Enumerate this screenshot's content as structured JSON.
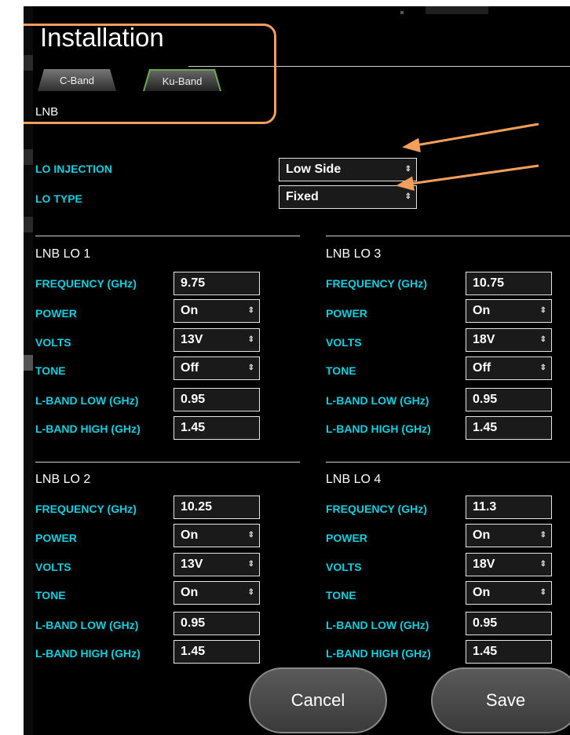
{
  "window": {
    "title": "Installation"
  },
  "tabs": [
    {
      "label": "C-Band",
      "active": false
    },
    {
      "label": "Ku-Band",
      "active": true
    }
  ],
  "section_label": "LNB",
  "lo_injection": {
    "label": "LO INJECTION",
    "value": "Low Side"
  },
  "lo_type": {
    "label": "LO TYPE",
    "value": "Fixed"
  },
  "field_labels": {
    "frequency": "FREQUENCY (GHz)",
    "power": "POWER",
    "volts": "VOLTS",
    "tone": "TONE",
    "lband_low": "L-BAND LOW (GHz)",
    "lband_high": "L-BAND HIGH (GHz)"
  },
  "lnb": {
    "lo1": {
      "title": "LNB LO 1",
      "frequency": "9.75",
      "power": "On",
      "volts": "13V",
      "tone": "Off",
      "lband_low": "0.95",
      "lband_high": "1.45"
    },
    "lo2": {
      "title": "LNB LO 2",
      "frequency": "10.25",
      "power": "On",
      "volts": "13V",
      "tone": "On",
      "lband_low": "0.95",
      "lband_high": "1.45"
    },
    "lo3": {
      "title": "LNB LO 3",
      "frequency": "10.75",
      "power": "On",
      "volts": "18V",
      "tone": "Off",
      "lband_low": "0.95",
      "lband_high": "1.45"
    },
    "lo4": {
      "title": "LNB LO 4",
      "frequency": "11.3",
      "power": "On",
      "volts": "18V",
      "tone": "On",
      "lband_low": "0.95",
      "lband_high": "1.45"
    }
  },
  "buttons": {
    "cancel": "Cancel",
    "save": "Save"
  },
  "colors": {
    "label": "#0fd0e0",
    "annotation": "#f29f5c",
    "tab_active_border": "#6aa84f"
  }
}
